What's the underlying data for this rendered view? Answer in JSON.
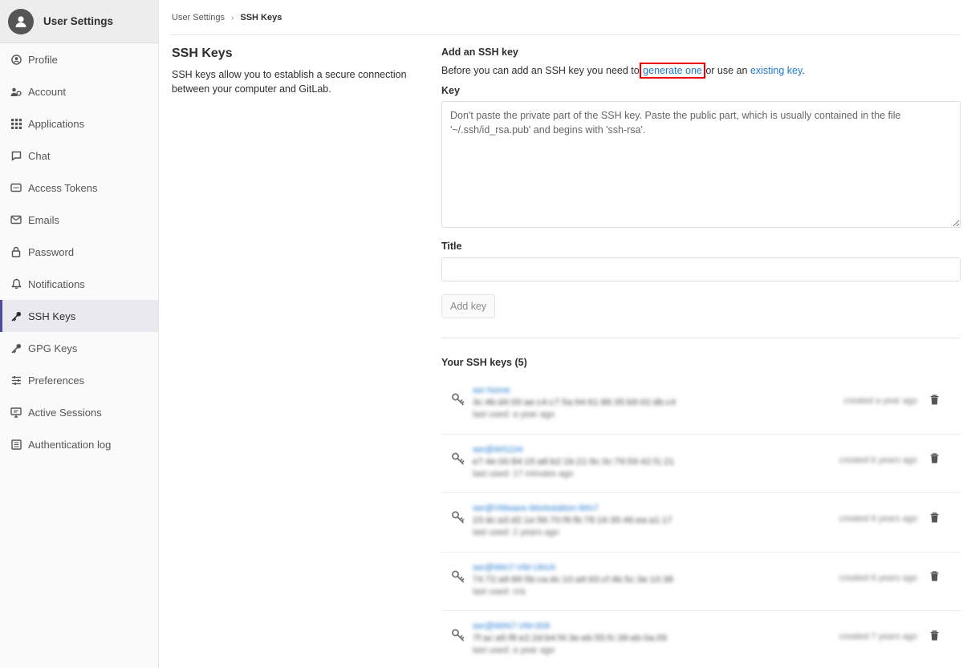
{
  "sidebar": {
    "title": "User Settings",
    "items": [
      {
        "label": "Profile",
        "icon": "profile-icon"
      },
      {
        "label": "Account",
        "icon": "account-icon"
      },
      {
        "label": "Applications",
        "icon": "applications-icon"
      },
      {
        "label": "Chat",
        "icon": "chat-icon"
      },
      {
        "label": "Access Tokens",
        "icon": "token-icon"
      },
      {
        "label": "Emails",
        "icon": "email-icon"
      },
      {
        "label": "Password",
        "icon": "lock-icon"
      },
      {
        "label": "Notifications",
        "icon": "bell-icon"
      },
      {
        "label": "SSH Keys",
        "icon": "key-icon",
        "active": true
      },
      {
        "label": "GPG Keys",
        "icon": "key-icon"
      },
      {
        "label": "Preferences",
        "icon": "sliders-icon"
      },
      {
        "label": "Active Sessions",
        "icon": "monitor-icon"
      },
      {
        "label": "Authentication log",
        "icon": "log-icon"
      }
    ]
  },
  "breadcrumb": {
    "parent": "User Settings",
    "separator": "›",
    "current": "SSH Keys"
  },
  "info": {
    "title": "SSH Keys",
    "description": "SSH keys allow you to establish a secure connection between your computer and GitLab."
  },
  "form": {
    "heading": "Add an SSH key",
    "intro_before": "Before you can add an SSH key you need to ",
    "generate_link": "generate one",
    "intro_middle": " or use an ",
    "existing_link": "existing key",
    "intro_end": ".",
    "key_label": "Key",
    "key_placeholder": "Don't paste the private part of the SSH key. Paste the public part, which is usually contained in the file '~/.ssh/id_rsa.pub' and begins with 'ssh-rsa'.",
    "title_label": "Title",
    "title_value": "",
    "add_button": "Add key"
  },
  "keys_section": {
    "heading": "Your SSH keys (5)",
    "keys": [
      {
        "name": "ser-home",
        "fingerprint": "3c:4b:d4:00:ae:c4:c7:5a:94:61:86:35:b9:02:db:c4",
        "last_used": "last used: a year ago",
        "created": "created a year ago"
      },
      {
        "name": "ser@WS104",
        "fingerprint": "e7:4e:00:84:15:a8:b2:1b:21:9c:3c:79:59:42:f1:21",
        "last_used": "last used: 17 minutes ago",
        "created": "created 6 years ago"
      },
      {
        "name": "ser@VMware-Workstation-Win7",
        "fingerprint": "23:dc:a3:d2:1e:56:70:f9:fb:78:16:35:46:ea:a1:17",
        "last_used": "last used: 2 years ago",
        "created": "created 6 years ago"
      },
      {
        "name": "ser@Win7-VM-Ulrich",
        "fingerprint": "74:72:a9:89:5b:ca:dc:10:a9:93:cf:4b:5c:3e:10:38",
        "last_used": "last used: n/a",
        "created": "created 6 years ago"
      },
      {
        "name": "ser@WIN7-VM-009",
        "fingerprint": "7f:ac:a5:f8:e2:2d:b4:f4:3e:eb:55:fc:39:eb:0a:09",
        "last_used": "last used: a year ago",
        "created": "created 7 years ago"
      }
    ]
  },
  "colors": {
    "link": "#1f78d1",
    "active_indicator": "#4b4ba3",
    "highlight_box": "#e00000"
  }
}
